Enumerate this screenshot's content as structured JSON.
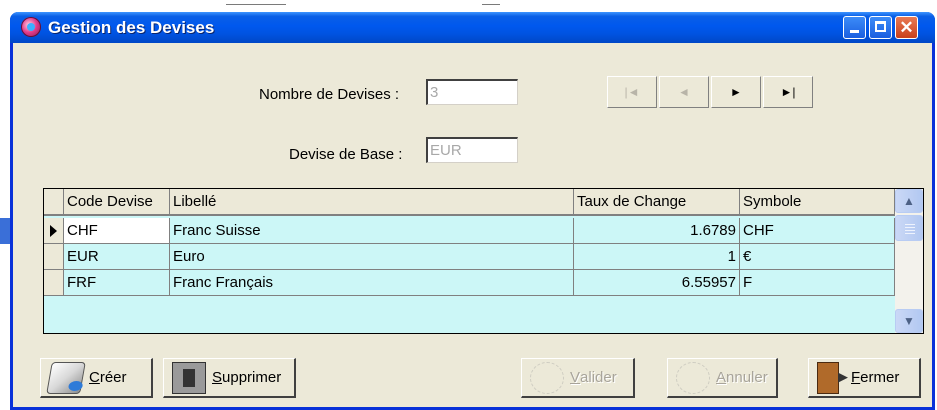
{
  "window": {
    "title": "Gestion des Devises"
  },
  "form": {
    "count_label": "Nombre de Devises :",
    "count_value": "3",
    "base_label": "Devise de Base :",
    "base_value": "EUR"
  },
  "nav": {
    "first": "|◄",
    "prev": "◄",
    "next": "►",
    "last": "►|"
  },
  "table": {
    "headers": [
      "Code Devise",
      "Libellé",
      "Taux de Change",
      "Symbole"
    ],
    "rows": [
      {
        "code": "CHF",
        "label": "Franc Suisse",
        "rate": "1.6789",
        "symbol": "CHF"
      },
      {
        "code": "EUR",
        "label": "Euro",
        "rate": "1",
        "symbol": "€"
      },
      {
        "code": "FRF",
        "label": "Franc Français",
        "rate": "6.55957",
        "symbol": "F"
      }
    ]
  },
  "buttons": {
    "create_mnemonic": "C",
    "create_rest": "réer",
    "delete_mnemonic": "S",
    "delete_rest": "upprimer",
    "validate_mnemonic": "V",
    "validate_rest": "alider",
    "cancel_mnemonic": "A",
    "cancel_rest": "nnuler",
    "close_mnemonic": "F",
    "close_rest": "ermer"
  },
  "colors": {
    "titlebar": "#0058ee",
    "grid_background": "#ccf7f7",
    "dialog_background": "#ece9d8"
  }
}
